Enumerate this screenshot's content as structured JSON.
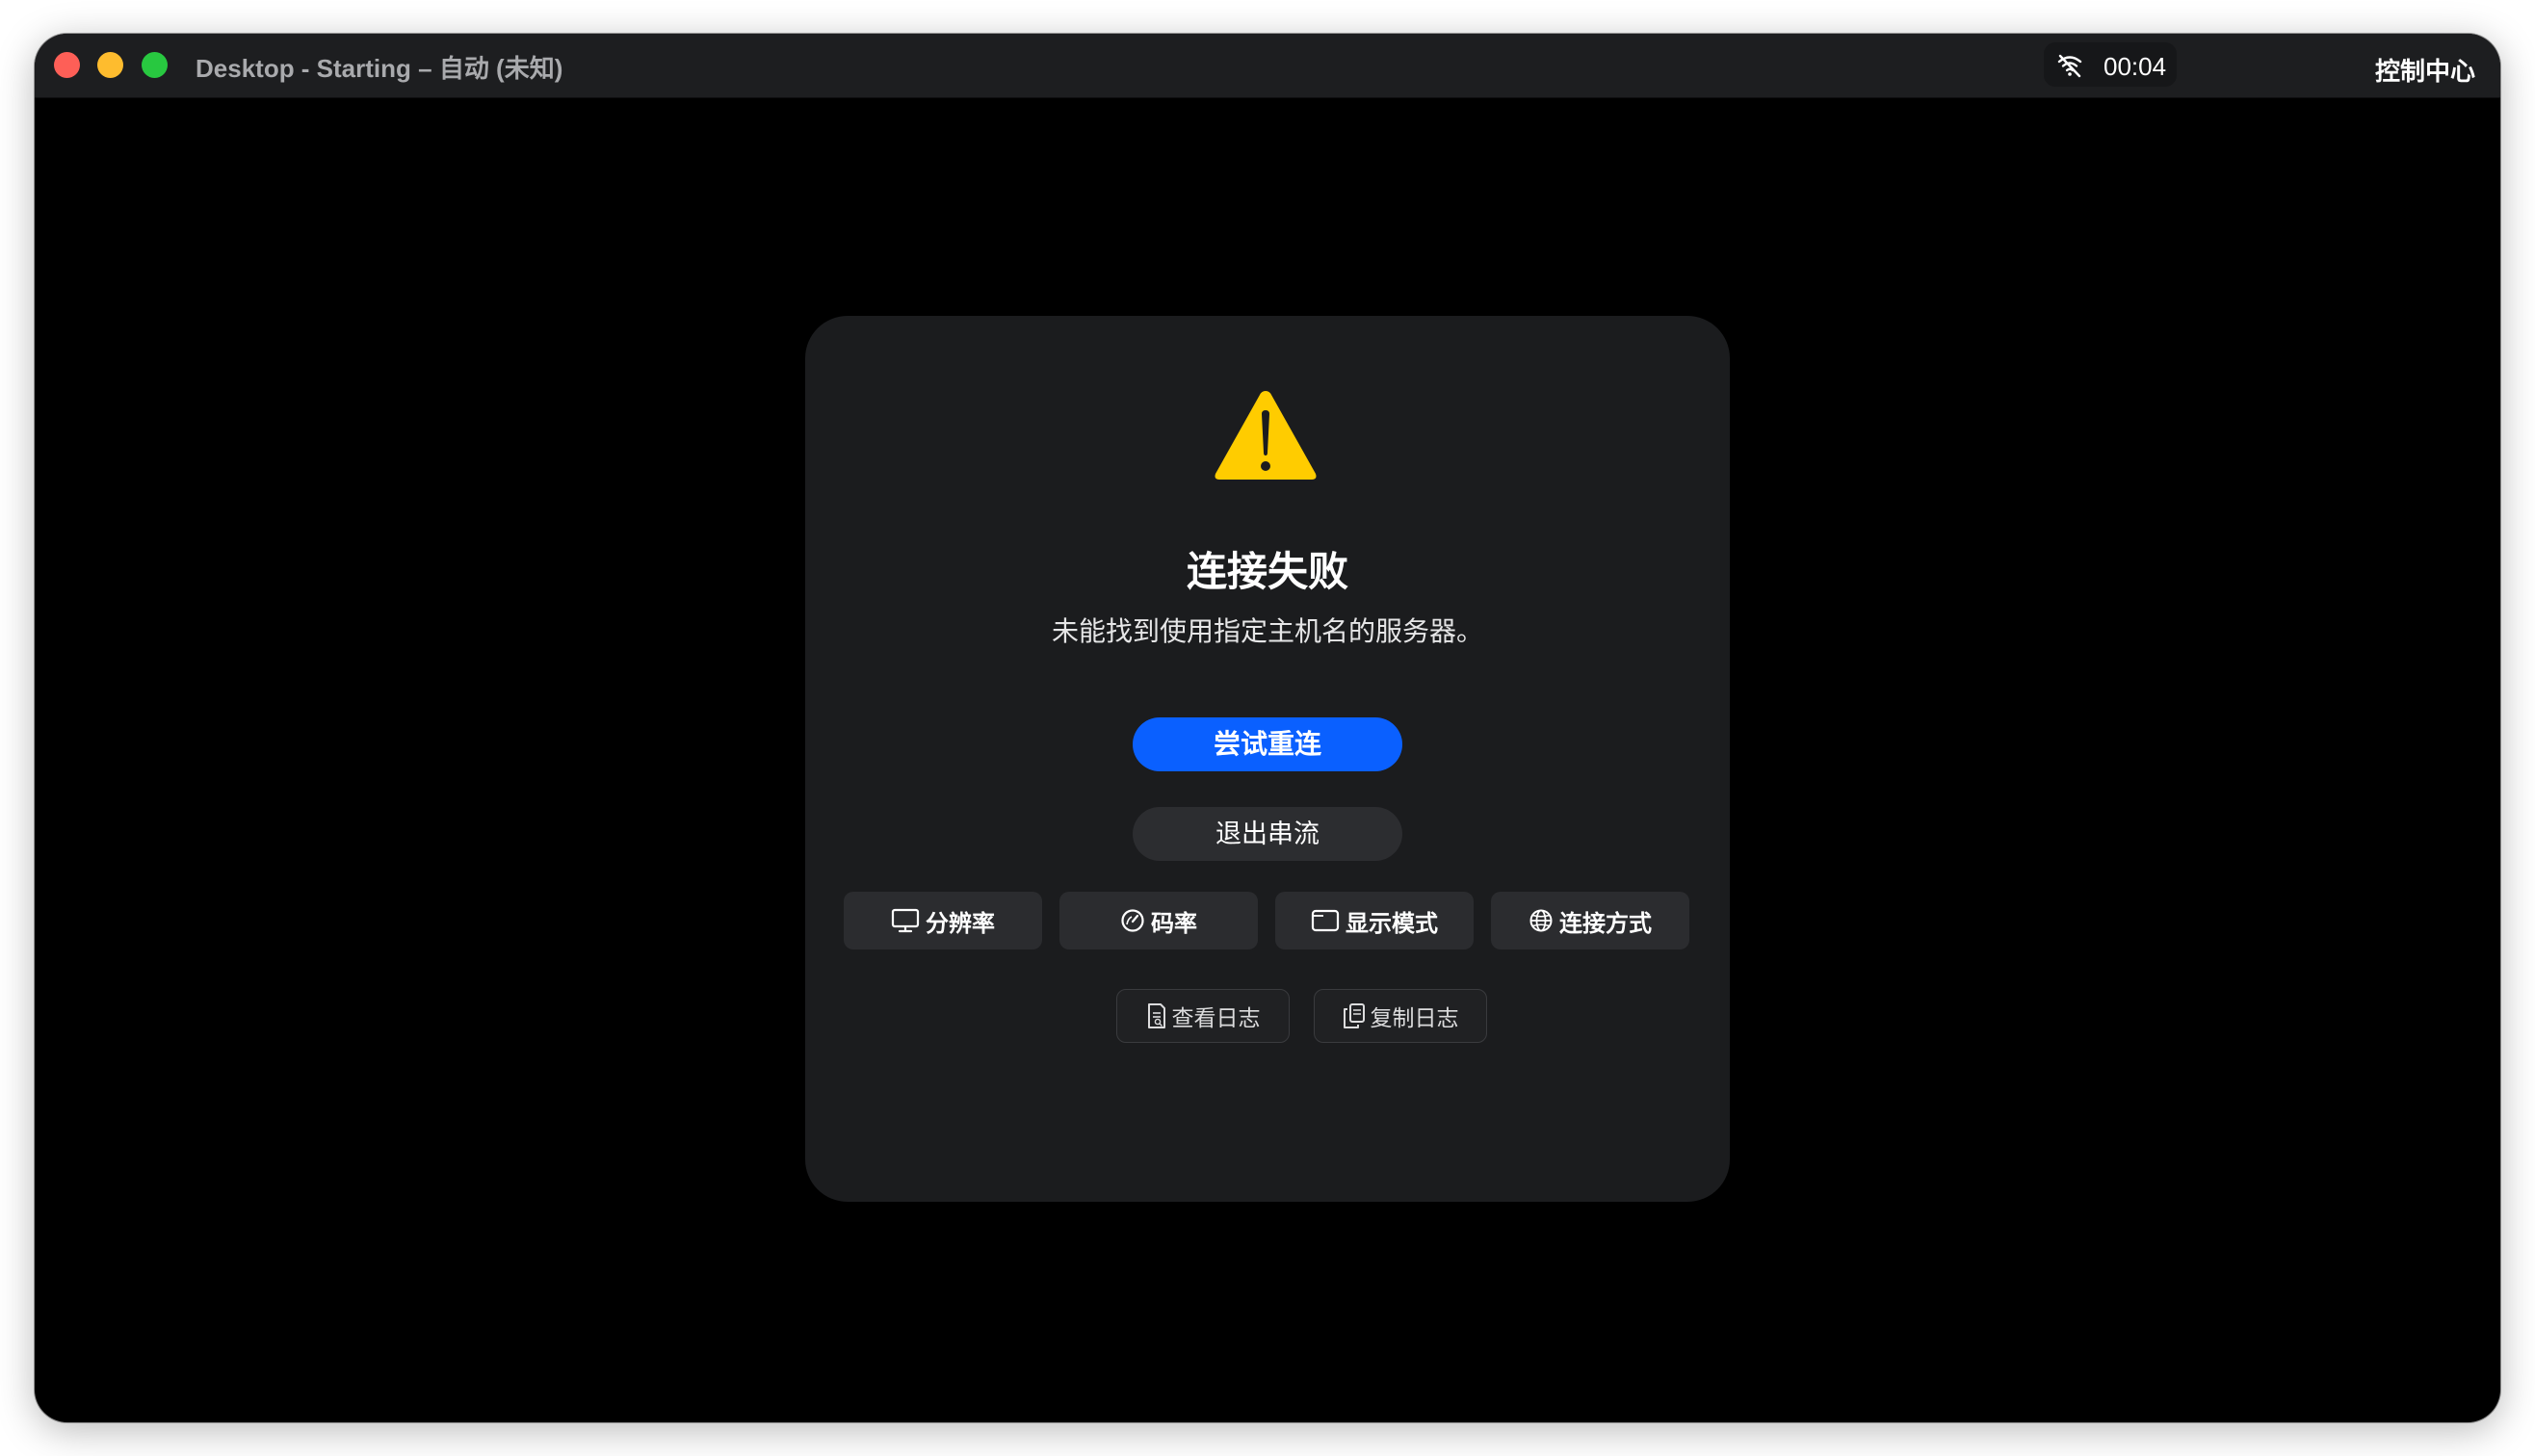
{
  "window": {
    "title": "Desktop - Starting – 自动 (未知)",
    "clock": "00:04",
    "control_center": "控制中心"
  },
  "dialog": {
    "title": "连接失败",
    "message": "未能找到使用指定主机名的服务器。",
    "retry_label": "尝试重连",
    "exit_label": "退出串流",
    "options": [
      {
        "label": "分辨率",
        "icon": "monitor-icon"
      },
      {
        "label": "码率",
        "icon": "gauge-icon"
      },
      {
        "label": "显示模式",
        "icon": "window-icon"
      },
      {
        "label": "连接方式",
        "icon": "globe-icon"
      }
    ],
    "logs": [
      {
        "label": "查看日志",
        "icon": "document-icon"
      },
      {
        "label": "复制日志",
        "icon": "copy-icon"
      }
    ]
  },
  "colors": {
    "accent": "#0a60ff",
    "warning": "#ffcc00",
    "card_bg": "#1b1c1e",
    "titlebar_bg": "#1d1e20"
  }
}
